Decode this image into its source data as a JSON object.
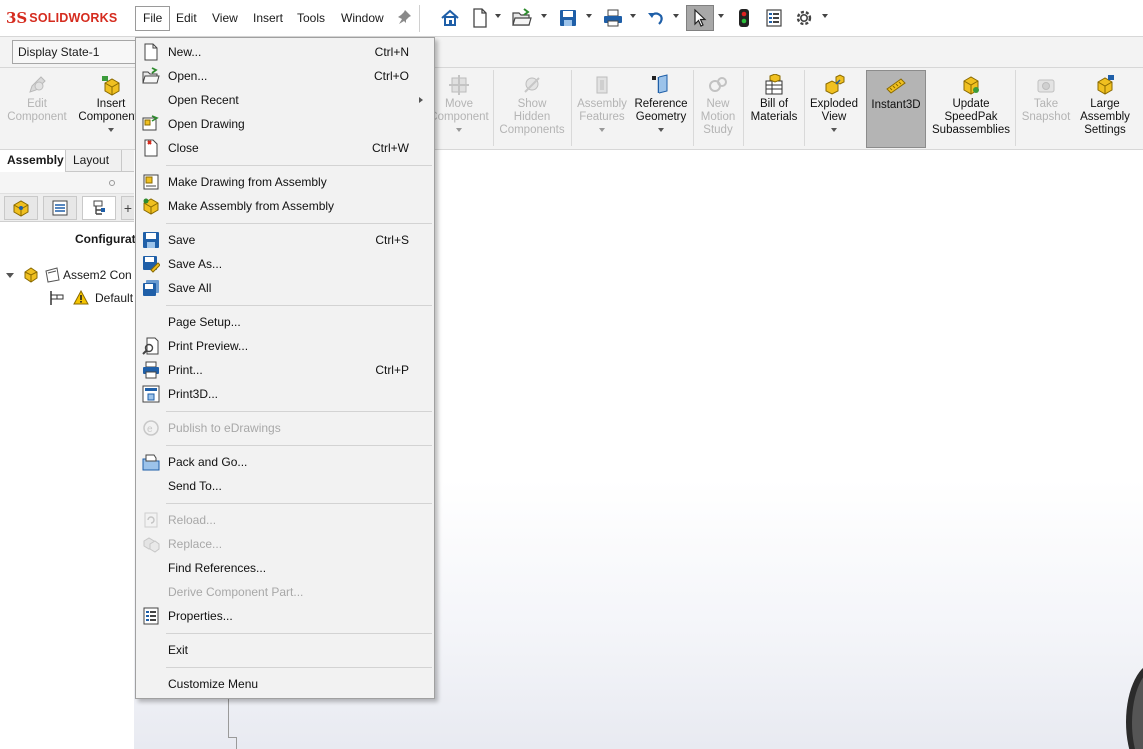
{
  "app": {
    "logo_mark": "3S",
    "logo_text": "SOLIDWORKS"
  },
  "menubar": {
    "items": [
      "File",
      "Edit",
      "View",
      "Insert",
      "Tools",
      "Window"
    ],
    "active": "File"
  },
  "quick_toolbar": {
    "icons": [
      "home-icon",
      "new-document-icon",
      "open-icon",
      "save-icon",
      "print-icon",
      "undo-icon",
      "select-cursor-icon",
      "rebuild-traffic-light-icon",
      "file-properties-icon",
      "options-gear-icon"
    ]
  },
  "display_state": {
    "value": "Display State-1"
  },
  "ribbon": {
    "buttons": [
      {
        "label1": "Edit",
        "label2": "Component",
        "label3": "",
        "disabled": true,
        "caret": false
      },
      {
        "label1": "Insert",
        "label2": "Components",
        "label3": "",
        "disabled": false,
        "caret": true
      },
      {
        "label1": "Move",
        "label2": "Component",
        "label3": "",
        "disabled": true,
        "caret": true
      },
      {
        "label1": "Show",
        "label2": "Hidden",
        "label3": "Components",
        "disabled": true,
        "caret": false
      },
      {
        "label1": "Assembly",
        "label2": "Features",
        "label3": "",
        "disabled": true,
        "caret": true
      },
      {
        "label1": "Reference",
        "label2": "Geometry",
        "label3": "",
        "disabled": false,
        "caret": true
      },
      {
        "label1": "New",
        "label2": "Motion",
        "label3": "Study",
        "disabled": true,
        "caret": false
      },
      {
        "label1": "Bill of",
        "label2": "Materials",
        "label3": "",
        "disabled": false,
        "caret": false
      },
      {
        "label1": "Exploded",
        "label2": "View",
        "label3": "",
        "disabled": false,
        "caret": true
      },
      {
        "label1": "Instant3D",
        "label2": "",
        "label3": "",
        "disabled": false,
        "caret": false,
        "pressed": true
      },
      {
        "label1": "Update",
        "label2": "SpeedPak",
        "label3": "Subassemblies",
        "disabled": false,
        "caret": false
      },
      {
        "label1": "Take",
        "label2": "Snapshot",
        "label3": "",
        "disabled": true,
        "caret": false
      },
      {
        "label1": "Large",
        "label2": "Assembly",
        "label3": "Settings",
        "disabled": false,
        "caret": false
      }
    ]
  },
  "tabs": {
    "items": [
      "Assembly",
      "Layout"
    ],
    "active": "Assembly"
  },
  "feature_manager": {
    "title": "Configurat",
    "tree": [
      {
        "label": "Assem2 Con"
      },
      {
        "label": "Default"
      }
    ]
  },
  "file_menu": {
    "items": [
      {
        "label": "New...",
        "shortcut": "Ctrl+N",
        "icon": "new-document-icon",
        "disabled": false
      },
      {
        "label": "Open...",
        "shortcut": "Ctrl+O",
        "icon": "open-folder-icon",
        "disabled": false
      },
      {
        "label": "Open Recent",
        "shortcut": "",
        "icon": "",
        "disabled": false,
        "submenu": true
      },
      {
        "label": "Open Drawing",
        "shortcut": "",
        "icon": "open-drawing-icon",
        "disabled": false
      },
      {
        "label": "Close",
        "shortcut": "Ctrl+W",
        "icon": "close-document-icon",
        "disabled": false
      },
      {
        "label": "Make Drawing from Assembly",
        "shortcut": "",
        "icon": "make-drawing-icon",
        "disabled": false
      },
      {
        "label": "Make Assembly from Assembly",
        "shortcut": "",
        "icon": "make-assembly-icon",
        "disabled": false
      },
      {
        "label": "Save",
        "shortcut": "Ctrl+S",
        "icon": "save-icon",
        "disabled": false
      },
      {
        "label": "Save As...",
        "shortcut": "",
        "icon": "save-as-icon",
        "disabled": false
      },
      {
        "label": "Save All",
        "shortcut": "",
        "icon": "save-all-icon",
        "disabled": false
      },
      {
        "label": "Page Setup...",
        "shortcut": "",
        "icon": "",
        "disabled": false
      },
      {
        "label": "Print Preview...",
        "shortcut": "",
        "icon": "print-preview-icon",
        "disabled": false
      },
      {
        "label": "Print...",
        "shortcut": "Ctrl+P",
        "icon": "print-icon",
        "disabled": false
      },
      {
        "label": "Print3D...",
        "shortcut": "",
        "icon": "print3d-icon",
        "disabled": false
      },
      {
        "label": "Publish to eDrawings",
        "shortcut": "",
        "icon": "edrawings-icon",
        "disabled": true
      },
      {
        "label": "Pack and Go...",
        "shortcut": "",
        "icon": "pack-and-go-icon",
        "disabled": false
      },
      {
        "label": "Send To...",
        "shortcut": "",
        "icon": "",
        "disabled": false
      },
      {
        "label": "Reload...",
        "shortcut": "",
        "icon": "reload-icon",
        "disabled": true
      },
      {
        "label": "Replace...",
        "shortcut": "",
        "icon": "replace-icon",
        "disabled": true
      },
      {
        "label": "Find References...",
        "shortcut": "",
        "icon": "",
        "disabled": false
      },
      {
        "label": "Derive Component Part...",
        "shortcut": "",
        "icon": "",
        "disabled": true
      },
      {
        "label": "Properties...",
        "shortcut": "",
        "icon": "properties-icon",
        "disabled": false
      },
      {
        "label": "Exit",
        "shortcut": "",
        "icon": "",
        "disabled": false
      },
      {
        "label": "Customize Menu",
        "shortcut": "",
        "icon": "",
        "disabled": false
      }
    ]
  },
  "colors": {
    "brand_red": "#d52b1e",
    "menu_bg": "#f2f2f2",
    "disabled_text": "#a8a8a8",
    "pressed_bg": "#b4b4b4"
  }
}
